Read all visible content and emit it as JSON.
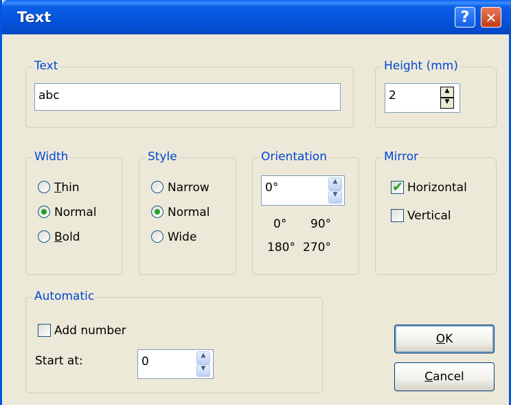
{
  "window": {
    "title": "Text",
    "help_glyph": "?",
    "close_glyph": "✕"
  },
  "text_group": {
    "legend": "Text",
    "value": "abc"
  },
  "height_group": {
    "legend": "Height (mm)",
    "value": "2"
  },
  "width_group": {
    "legend": "Width",
    "options": [
      {
        "accel": "T",
        "rest": "hin",
        "selected": false
      },
      {
        "accel": "",
        "rest": "Normal",
        "selected": true
      },
      {
        "accel": "B",
        "rest": "old",
        "selected": false
      }
    ]
  },
  "style_group": {
    "legend": "Style",
    "options": [
      {
        "label": "Narrow",
        "selected": false
      },
      {
        "label": "Normal",
        "selected": true
      },
      {
        "label": "Wide",
        "selected": false
      }
    ]
  },
  "orientation_group": {
    "legend": "Orientation",
    "value": "0°",
    "presets": [
      "0°",
      "90°",
      "180°",
      "270°"
    ]
  },
  "mirror_group": {
    "legend": "Mirror",
    "horizontal": {
      "label": "Horizontal",
      "checked": true
    },
    "vertical": {
      "label": "Vertical",
      "checked": false
    }
  },
  "automatic_group": {
    "legend": "Automatic",
    "add_number": {
      "label": "Add number",
      "checked": false
    },
    "start_at_label": "Start at:",
    "start_at_value": "0"
  },
  "buttons": {
    "ok": {
      "accel": "O",
      "rest": "K"
    },
    "cancel": {
      "accel": "C",
      "rest": "ancel"
    }
  }
}
